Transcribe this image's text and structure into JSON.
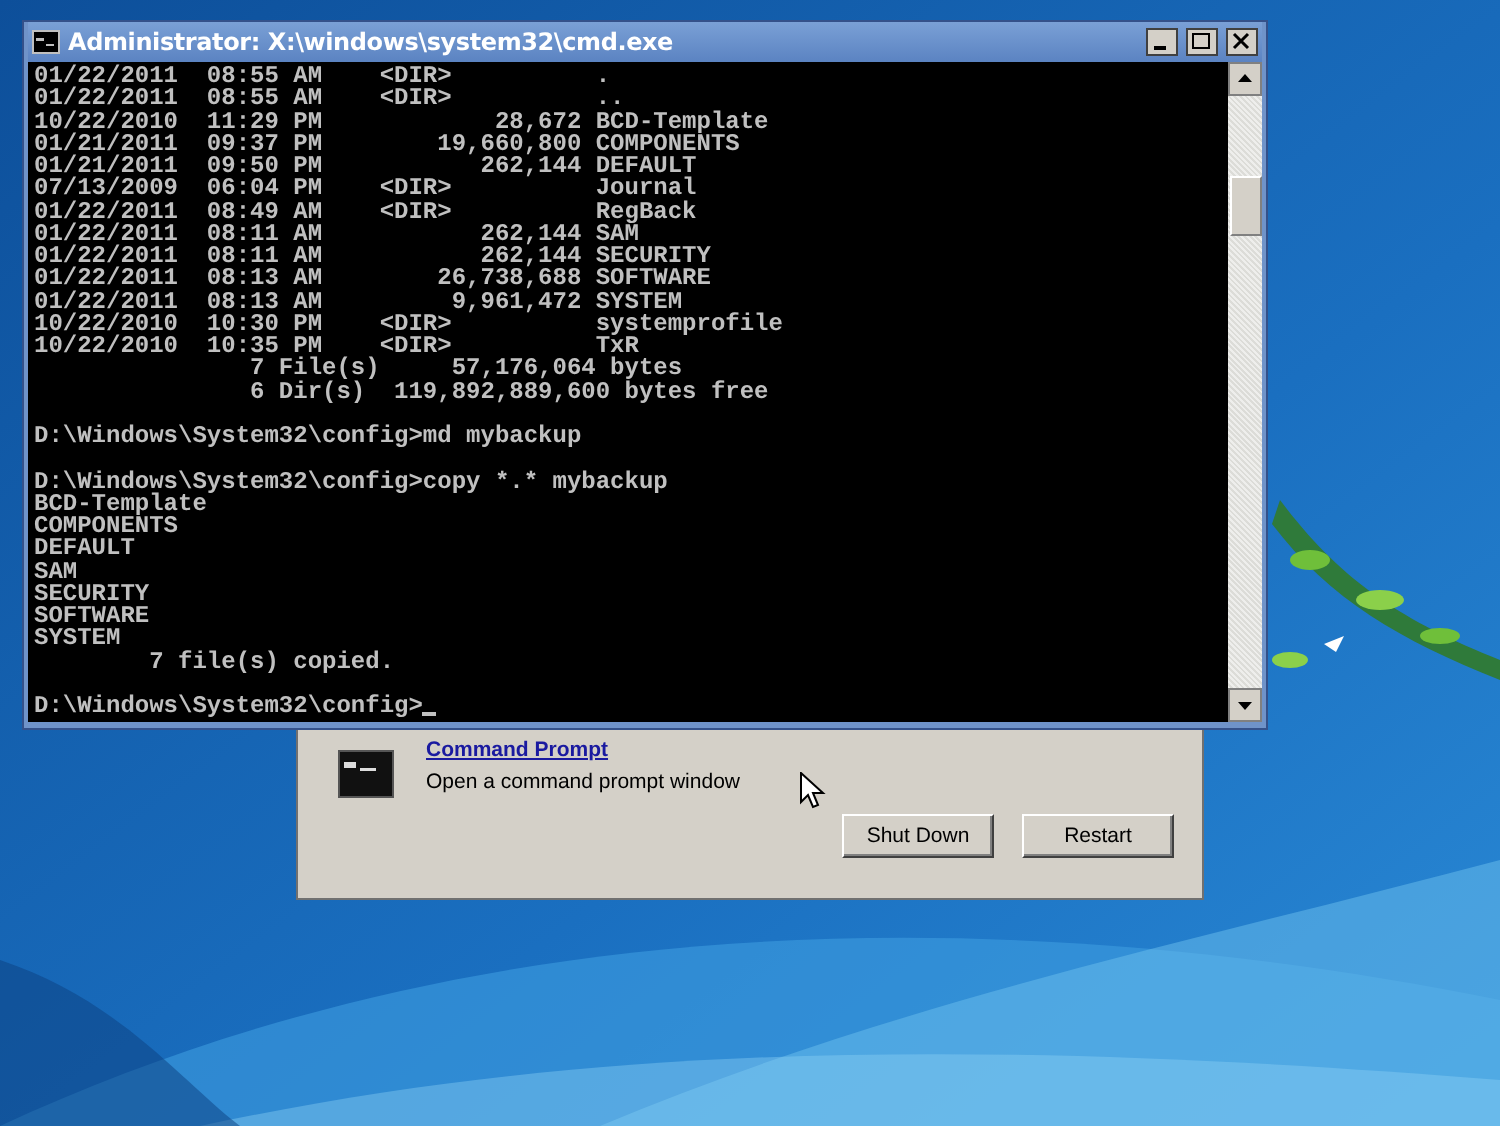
{
  "console_window": {
    "title": "Administrator: X:\\windows\\system32\\cmd.exe",
    "blocks": [
      [
        "01/22/2011  08:55 AM    <DIR>          .",
        "01/22/2011  08:55 AM    <DIR>          ..",
        "10/22/2010  11:29 PM            28,672 BCD-Template",
        "01/21/2011  09:37 PM        19,660,800 COMPONENTS",
        "01/21/2011  09:50 PM           262,144 DEFAULT",
        "07/13/2009  06:04 PM    <DIR>          Journal",
        "01/22/2011  08:49 AM    <DIR>          RegBack",
        "01/22/2011  08:11 AM           262,144 SAM",
        "01/22/2011  08:11 AM           262,144 SECURITY",
        "01/22/2011  08:13 AM        26,738,688 SOFTWARE",
        "01/22/2011  08:13 AM         9,961,472 SYSTEM",
        "10/22/2010  10:30 PM    <DIR>          systemprofile",
        "10/22/2010  10:35 PM    <DIR>          TxR",
        "               7 File(s)     57,176,064 bytes",
        "               6 Dir(s)  119,892,889,600 bytes free"
      ],
      [
        "D:\\Windows\\System32\\config>md mybackup"
      ],
      [
        "D:\\Windows\\System32\\config>copy *.* mybackup",
        "BCD-Template",
        "COMPONENTS",
        "DEFAULT",
        "SAM",
        "SECURITY",
        "SOFTWARE",
        "SYSTEM",
        "        7 file(s) copied."
      ],
      [
        "D:\\Windows\\System32\\config>"
      ]
    ]
  },
  "recovery_panel": {
    "tool_link": "Command Prompt",
    "tool_description": "Open a command prompt window",
    "buttons": [
      "Shut Down",
      "Restart"
    ]
  }
}
